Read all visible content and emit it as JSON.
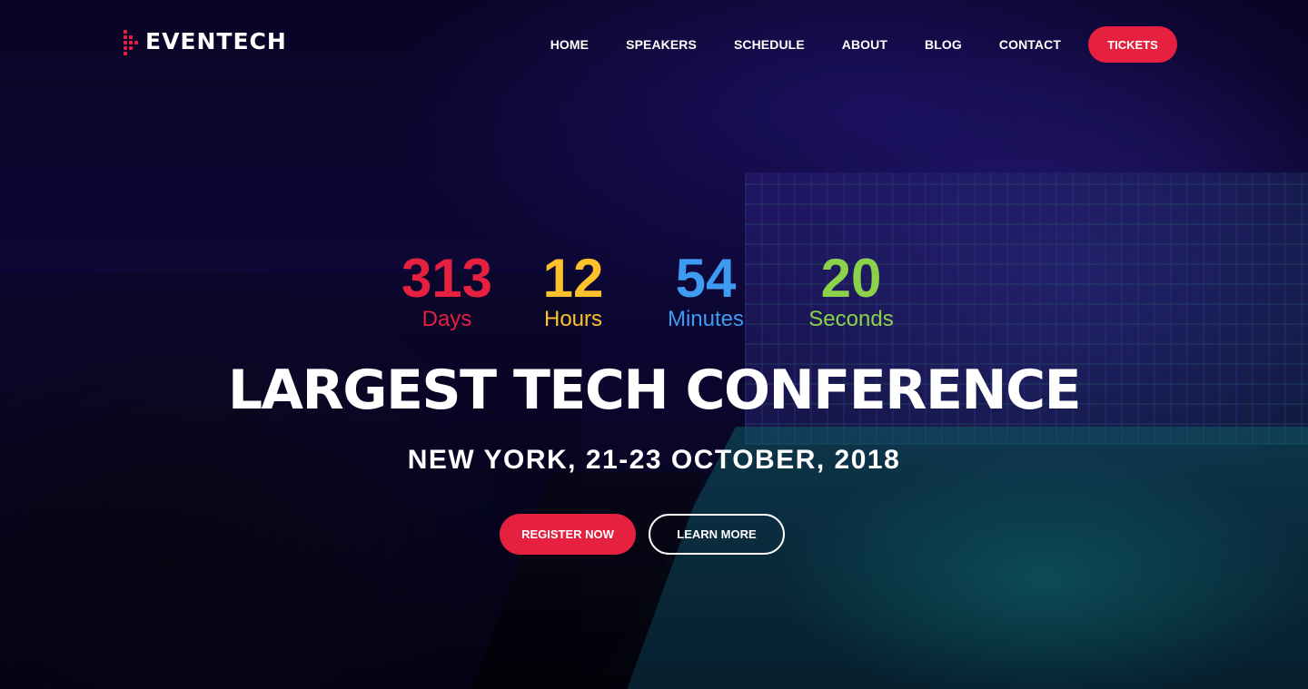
{
  "brand": {
    "name": "EVENTECH",
    "accent_color": "#e6203f"
  },
  "nav": {
    "items": [
      {
        "label": "HOME"
      },
      {
        "label": "SPEAKERS"
      },
      {
        "label": "SCHEDULE"
      },
      {
        "label": "ABOUT"
      },
      {
        "label": "BLOG"
      },
      {
        "label": "CONTACT"
      }
    ],
    "cta_label": "TICKETS"
  },
  "countdown": {
    "days": {
      "value": "313",
      "label": "Days",
      "color": "#e6203f"
    },
    "hours": {
      "value": "12",
      "label": "Hours",
      "color": "#ffc12b"
    },
    "minutes": {
      "value": "54",
      "label": "Minutes",
      "color": "#3e9bf2"
    },
    "seconds": {
      "value": "20",
      "label": "Seconds",
      "color": "#8bd24a"
    }
  },
  "hero": {
    "title": "LARGEST TECH CONFERENCE",
    "subtitle": "NEW YORK, 21-23 OCTOBER, 2018",
    "primary_button": "REGISTER NOW",
    "secondary_button": "LEARN MORE"
  }
}
